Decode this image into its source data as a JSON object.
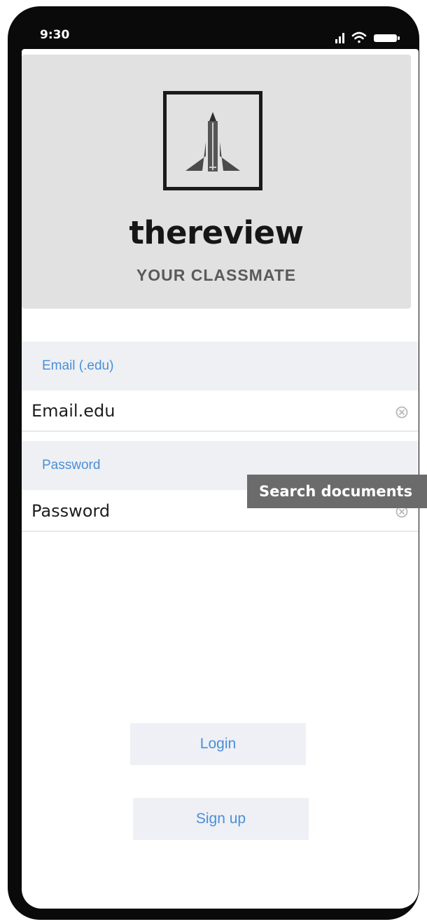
{
  "status_bar": {
    "time": "9:30",
    "icons": [
      "cellular-signal-icon",
      "wifi-icon",
      "battery-icon"
    ]
  },
  "brand": {
    "logo_icon": "pencil-rocket-logo",
    "title": "thereview",
    "subtitle": "YOUR CLASSMATE"
  },
  "email": {
    "label": "Email (.edu)",
    "placeholder": "Email.edu",
    "clear_icon": "clear-icon"
  },
  "password": {
    "label": "Password",
    "placeholder": "Password",
    "clear_icon": "clear-icon"
  },
  "tooltip": {
    "text": "Search documents"
  },
  "actions": {
    "login_label": "Login",
    "signup_label": "Sign up"
  },
  "colors": {
    "accent": "#4a8fd8",
    "hero_bg": "#e1e1e1",
    "field_label_bg": "#eef0f4",
    "button_bg": "#eef0f5",
    "tooltip_bg": "#6b6b6b",
    "frame": "#0a0a0a"
  }
}
